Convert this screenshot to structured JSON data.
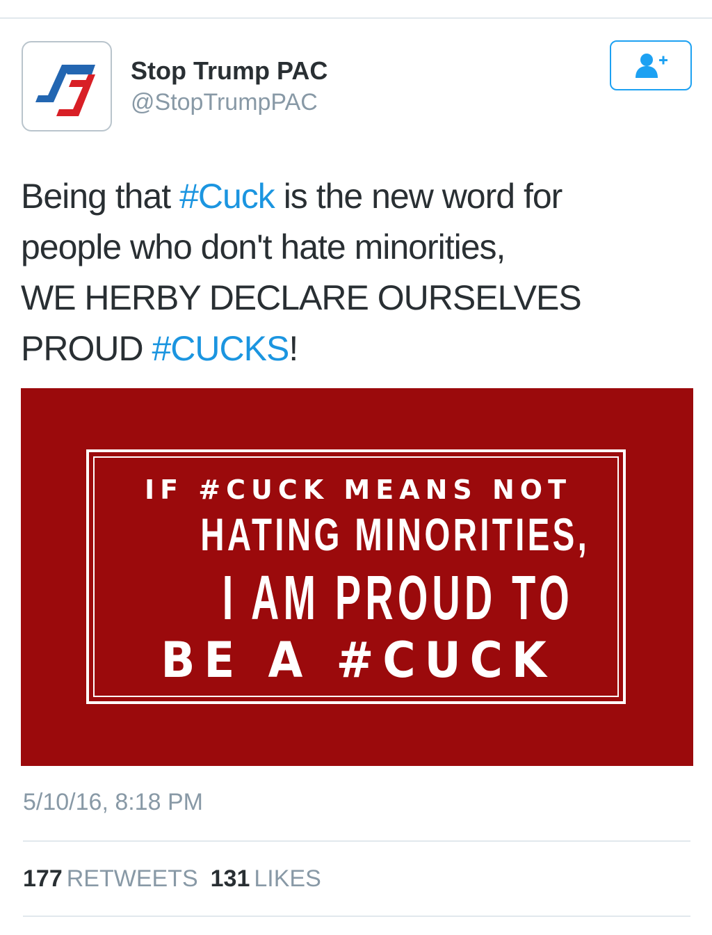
{
  "account": {
    "display_name": "Stop Trump PAC",
    "handle": "@StopTrumpPAC",
    "avatar_icon": "stop-trump-pac-logo",
    "avatar_colors": [
      "#2366b1",
      "#d81f26"
    ]
  },
  "follow_button": {
    "icon": "follow-user-plus-icon",
    "color": "#1da1f2"
  },
  "tweet": {
    "line1_before": "Being that ",
    "hashtag1": "#Cuck",
    "line1_after": " is the new word for",
    "line2": "people who don't hate minorities,",
    "line3": "WE HERBY DECLARE OURSELVES",
    "line4_before": "PROUD ",
    "hashtag2": "#CUCKS",
    "line4_after": "!"
  },
  "media": {
    "background_color": "#9b0a0c",
    "line1": "IF #CUCK MEANS NOT",
    "line2": "HATING MINORITIES,",
    "line3": "I AM PROUD TO",
    "line4": "BE A #CUCK"
  },
  "timestamp": "5/10/16, 8:18 PM",
  "stats": {
    "retweets_count": "177",
    "retweets_label": "RETWEETS",
    "likes_count": "131",
    "likes_label": "LIKES"
  },
  "colors": {
    "link": "#1b95e0",
    "muted": "#8899a6",
    "text": "#292f33",
    "divider": "#e1e8ed"
  }
}
